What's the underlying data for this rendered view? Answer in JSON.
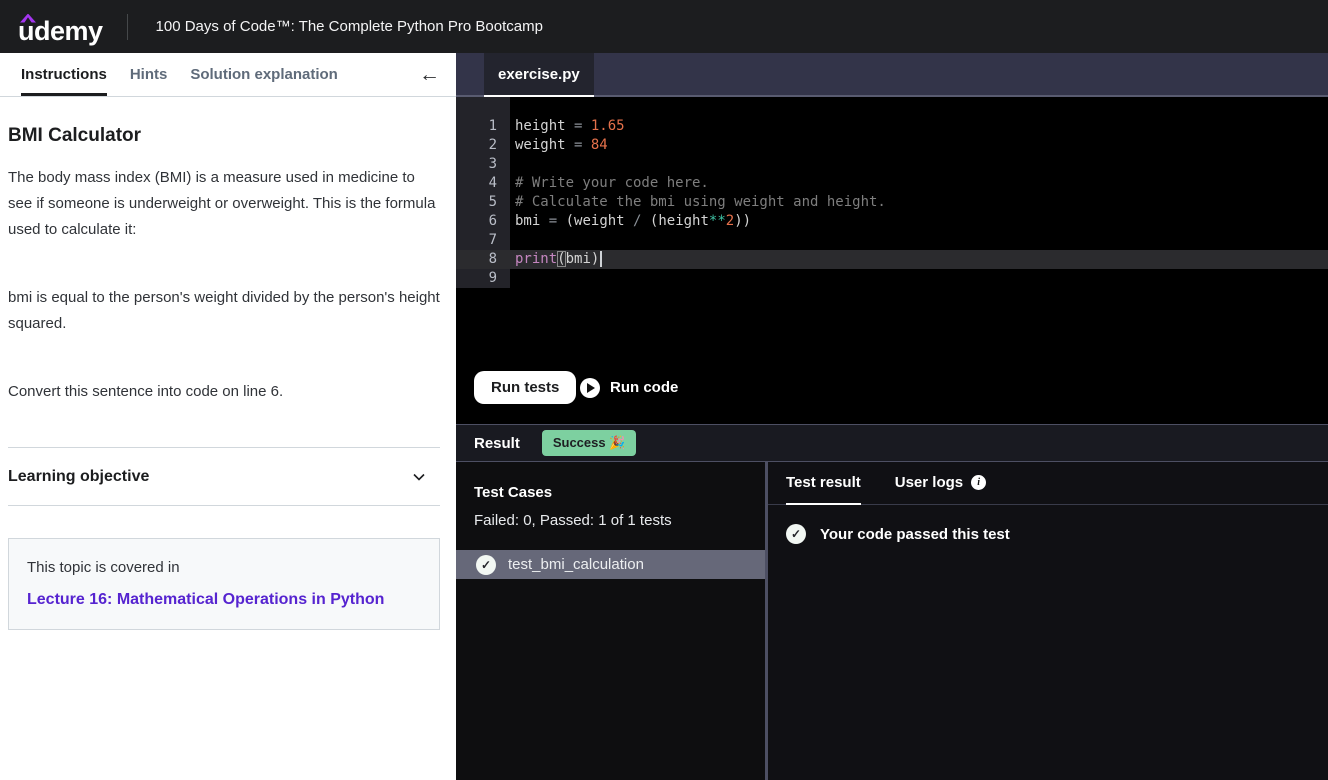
{
  "header": {
    "logo_text": "udemy",
    "course_title": "100 Days of Code™: The Complete Python Pro Bootcamp"
  },
  "instructions": {
    "tabs": {
      "instructions": "Instructions",
      "hints": "Hints",
      "solution": "Solution explanation"
    },
    "collapse_arrow": "←",
    "title": "BMI Calculator",
    "para1": "The body mass index (BMI) is a measure used in medicine to see if someone is underweight or overweight. This is the formula used to calculate it:",
    "para2": "bmi is equal to the person's weight divided by the person's height squared.",
    "para3": "Convert this sentence into code on line 6.",
    "learning_objective": "Learning objective",
    "topic_intro": "This topic is covered in",
    "topic_link": "Lecture 16: Mathematical Operations in Python"
  },
  "editor": {
    "file_tab": "exercise.py",
    "current_line": 8,
    "cursor_line": 8,
    "lines": [
      [
        [
          "id",
          "height"
        ],
        [
          "op",
          " = "
        ],
        [
          "num",
          "1.65"
        ]
      ],
      [
        [
          "id",
          "weight"
        ],
        [
          "op",
          " = "
        ],
        [
          "num",
          "84"
        ]
      ],
      [],
      [
        [
          "cm",
          "# Write your code here."
        ]
      ],
      [
        [
          "cm",
          "# Calculate the bmi using weight and height."
        ]
      ],
      [
        [
          "id",
          "bmi"
        ],
        [
          "op",
          " = "
        ],
        [
          "pn",
          "("
        ],
        [
          "id",
          "weight"
        ],
        [
          "op",
          " / "
        ],
        [
          "pn",
          "("
        ],
        [
          "id",
          "height"
        ],
        [
          "ts",
          "**"
        ],
        [
          "num",
          "2"
        ],
        [
          "pn",
          "))"
        ]
      ],
      [],
      [
        [
          "kw",
          "print"
        ],
        [
          "bm",
          "("
        ],
        [
          "id",
          "bmi"
        ],
        [
          "pn",
          ")"
        ]
      ],
      []
    ]
  },
  "actions": {
    "run_tests": "Run tests",
    "run_code": "Run code"
  },
  "result_bar": {
    "label": "Result",
    "status": "Success 🎉"
  },
  "test_cases": {
    "heading": "Test Cases",
    "summary": "Failed: 0, Passed: 1 of 1 tests",
    "items": [
      {
        "name": "test_bmi_calculation",
        "passed": true,
        "selected": true
      }
    ]
  },
  "test_result": {
    "tab_test_result": "Test result",
    "tab_user_logs": "User logs",
    "message": "Your code passed this test",
    "check_glyph": "✓"
  },
  "colors": {
    "udemy_purple": "#a435f0",
    "success_green": "#7dd0a0",
    "link_purple": "#5624d0",
    "selected_row_gray": "#666879"
  }
}
